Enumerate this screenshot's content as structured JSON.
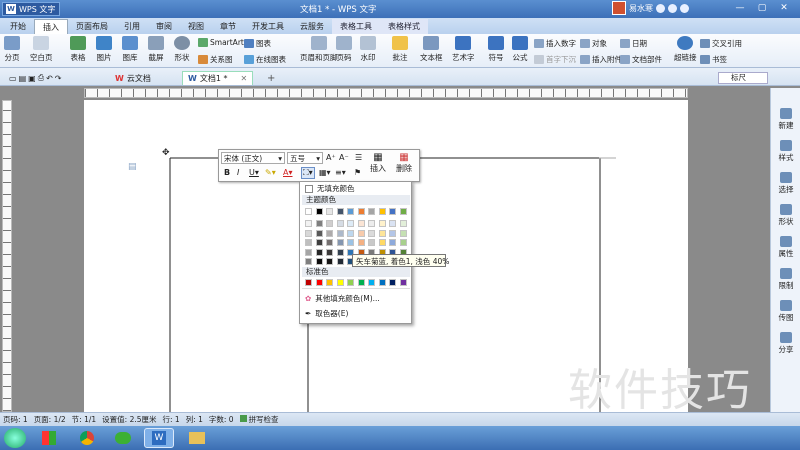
{
  "window": {
    "app_name": "WPS 文字",
    "title": "文档1 * - WPS 文字",
    "user_name": "易水寒",
    "controls": [
      "minimize-icon",
      "restore-icon",
      "close-icon"
    ]
  },
  "menu_tabs": [
    "开始",
    "插入",
    "页面布局",
    "引用",
    "审阅",
    "视图",
    "章节",
    "开发工具",
    "云服务",
    "表格工具",
    "表格样式"
  ],
  "active_tab": "插入",
  "ribbon": {
    "page_label": "分页",
    "blank_page_label": "空白页",
    "table_label": "表格",
    "picture_label": "图片",
    "gallery_label": "图库",
    "screenshot_label": "截屏",
    "shape_label": "形状",
    "smartart_label": "SmartArt",
    "chart_label": "图表",
    "relation_label": "关系图",
    "online_chart_label": "在线图表",
    "header_footer_label": "页眉和页脚",
    "page_num_label": "页码",
    "watermark_label": "水印",
    "comment_label": "批注",
    "textbox_label": "文本框",
    "wordart_label": "艺术字",
    "symbol_label": "符号",
    "formula_label": "公式",
    "insert_number_label": "插入数字",
    "object_label": "对象",
    "date_label": "日期",
    "first_letter_label": "首字下沉",
    "attachment_label": "插入附件",
    "doc_part_label": "文档部件",
    "hyperlink_label": "超链接",
    "cross_ref_label": "交叉引用",
    "bookmark_label": "书签"
  },
  "doc_tabs": [
    {
      "label": "云文档"
    },
    {
      "label": "文档1 *"
    }
  ],
  "search": {
    "placeholder": "标尺"
  },
  "right_panel": [
    "新建",
    "样式",
    "选择",
    "形状",
    "属性",
    "限制",
    "传图",
    "分享"
  ],
  "mini_toolbar": {
    "font": "宋体 (正文)",
    "size": "五号",
    "insert_label": "插入",
    "delete_label": "删除"
  },
  "color_menu": {
    "no_fill": "无填充颜色",
    "theme_header": "主题颜色",
    "standard_header": "标准色",
    "more_colors": "其他填充颜色(M)...",
    "eyedropper": "取色器(E)",
    "tooltip": "矢车菊蓝, 着色1, 浅色 40%",
    "theme_top_row": [
      "#ffffff",
      "#000000",
      "#e6e6e6",
      "#44546a",
      "#5b9bd5",
      "#ed7d31",
      "#a5a5a5",
      "#ffc000",
      "#4472c4",
      "#70ad47"
    ],
    "theme_shades": [
      [
        "#f2f2f2",
        "#7f7f7f",
        "#d0cece",
        "#d6dce4",
        "#deebf6",
        "#fbe5d5",
        "#ededed",
        "#fff2cc",
        "#dae3f3",
        "#e2efd9"
      ],
      [
        "#d8d8d8",
        "#595959",
        "#aeabab",
        "#adb9ca",
        "#bdd7ee",
        "#f7cbac",
        "#dbdbdb",
        "#fee599",
        "#b4c6e7",
        "#c5e0b3"
      ],
      [
        "#bfbfbf",
        "#3f3f3f",
        "#757070",
        "#8496b0",
        "#9cc3e5",
        "#f4b183",
        "#c9c9c9",
        "#ffd965",
        "#8eaadb",
        "#a8d08d"
      ],
      [
        "#a5a5a5",
        "#262626",
        "#3a3838",
        "#323f4f",
        "#2e75b5",
        "#c55a11",
        "#7b7b7b",
        "#bf9000",
        "#2f5496",
        "#538135"
      ],
      [
        "#7f7f7f",
        "#0c0c0c",
        "#171616",
        "#222a35",
        "#1f4e79",
        "#833c0b",
        "#525252",
        "#7f6000",
        "#1f3864",
        "#375623"
      ]
    ],
    "standard": [
      "#c00000",
      "#ff0000",
      "#ffc000",
      "#ffff00",
      "#92d050",
      "#00b050",
      "#00b0f0",
      "#0070c0",
      "#002060",
      "#7030a0"
    ]
  },
  "status_bar": {
    "page": "页码: 1",
    "pages": "页面: 1/2",
    "section": "节: 1/1",
    "position": "设置值: 2.5厘米",
    "line": "行: 1",
    "column": "列: 1",
    "words": "字数: 0",
    "spellcheck": "拼写检查"
  },
  "watermark_text": "软件技巧"
}
